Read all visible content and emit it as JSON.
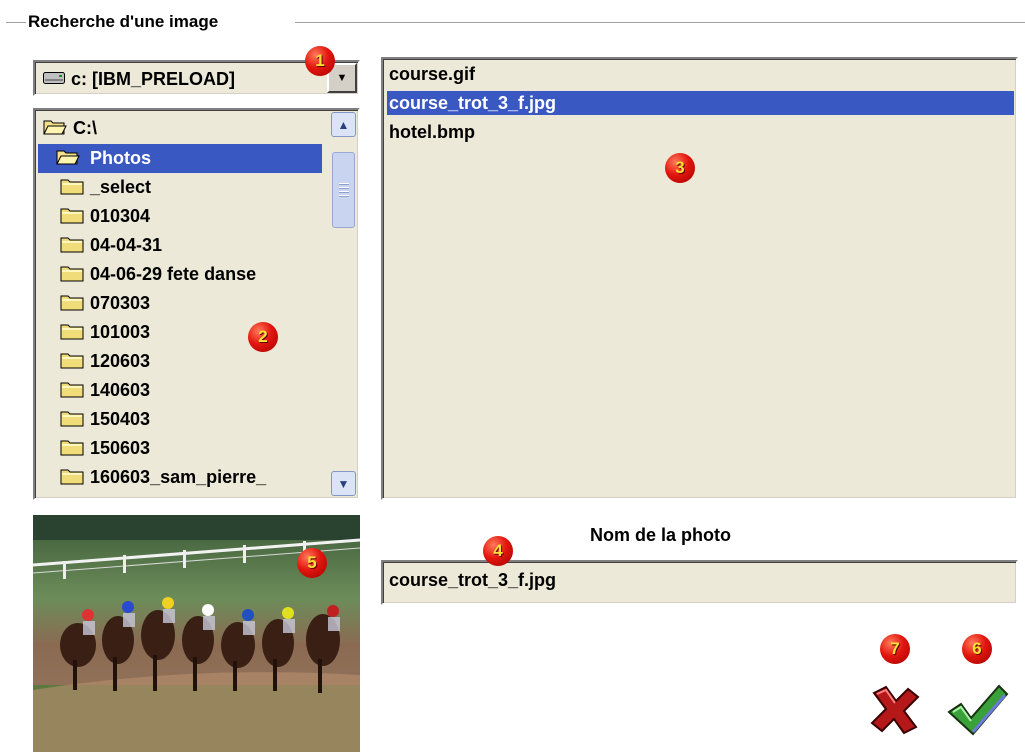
{
  "group_title": "Recherche d'une image",
  "drive": {
    "label": "c: [IBM_PRELOAD]",
    "icon": "drive-icon"
  },
  "folder_tree": {
    "root": "C:\\",
    "items": [
      {
        "label": "Photos",
        "icon": "folder-open-icon",
        "selected": true
      },
      {
        "label": "_select",
        "icon": "folder-icon"
      },
      {
        "label": "010304",
        "icon": "folder-icon"
      },
      {
        "label": "04-04-31",
        "icon": "folder-icon"
      },
      {
        "label": "04-06-29 fete danse",
        "icon": "folder-icon"
      },
      {
        "label": "070303",
        "icon": "folder-icon"
      },
      {
        "label": "101003",
        "icon": "folder-icon"
      },
      {
        "label": "120603",
        "icon": "folder-icon"
      },
      {
        "label": "140603",
        "icon": "folder-icon"
      },
      {
        "label": "150403",
        "icon": "folder-icon"
      },
      {
        "label": "150603",
        "icon": "folder-icon"
      },
      {
        "label": "160603_sam_pierre_",
        "icon": "folder-icon"
      }
    ]
  },
  "files": [
    {
      "name": "course.gif",
      "selected": false
    },
    {
      "name": "course_trot_3_f.jpg",
      "selected": true
    },
    {
      "name": "hotel.bmp",
      "selected": false
    }
  ],
  "name_section": {
    "heading": "Nom de la photo",
    "value": "course_trot_3_f.jpg"
  },
  "badges": [
    "1",
    "2",
    "3",
    "4",
    "5",
    "6",
    "7"
  ],
  "colors": {
    "selection": "#3a58c2",
    "panel": "#ece9d8",
    "badge": "#e3160f",
    "badge_text": "#ffe234",
    "cancel": "#b51818",
    "ok": "#3aa03a"
  }
}
